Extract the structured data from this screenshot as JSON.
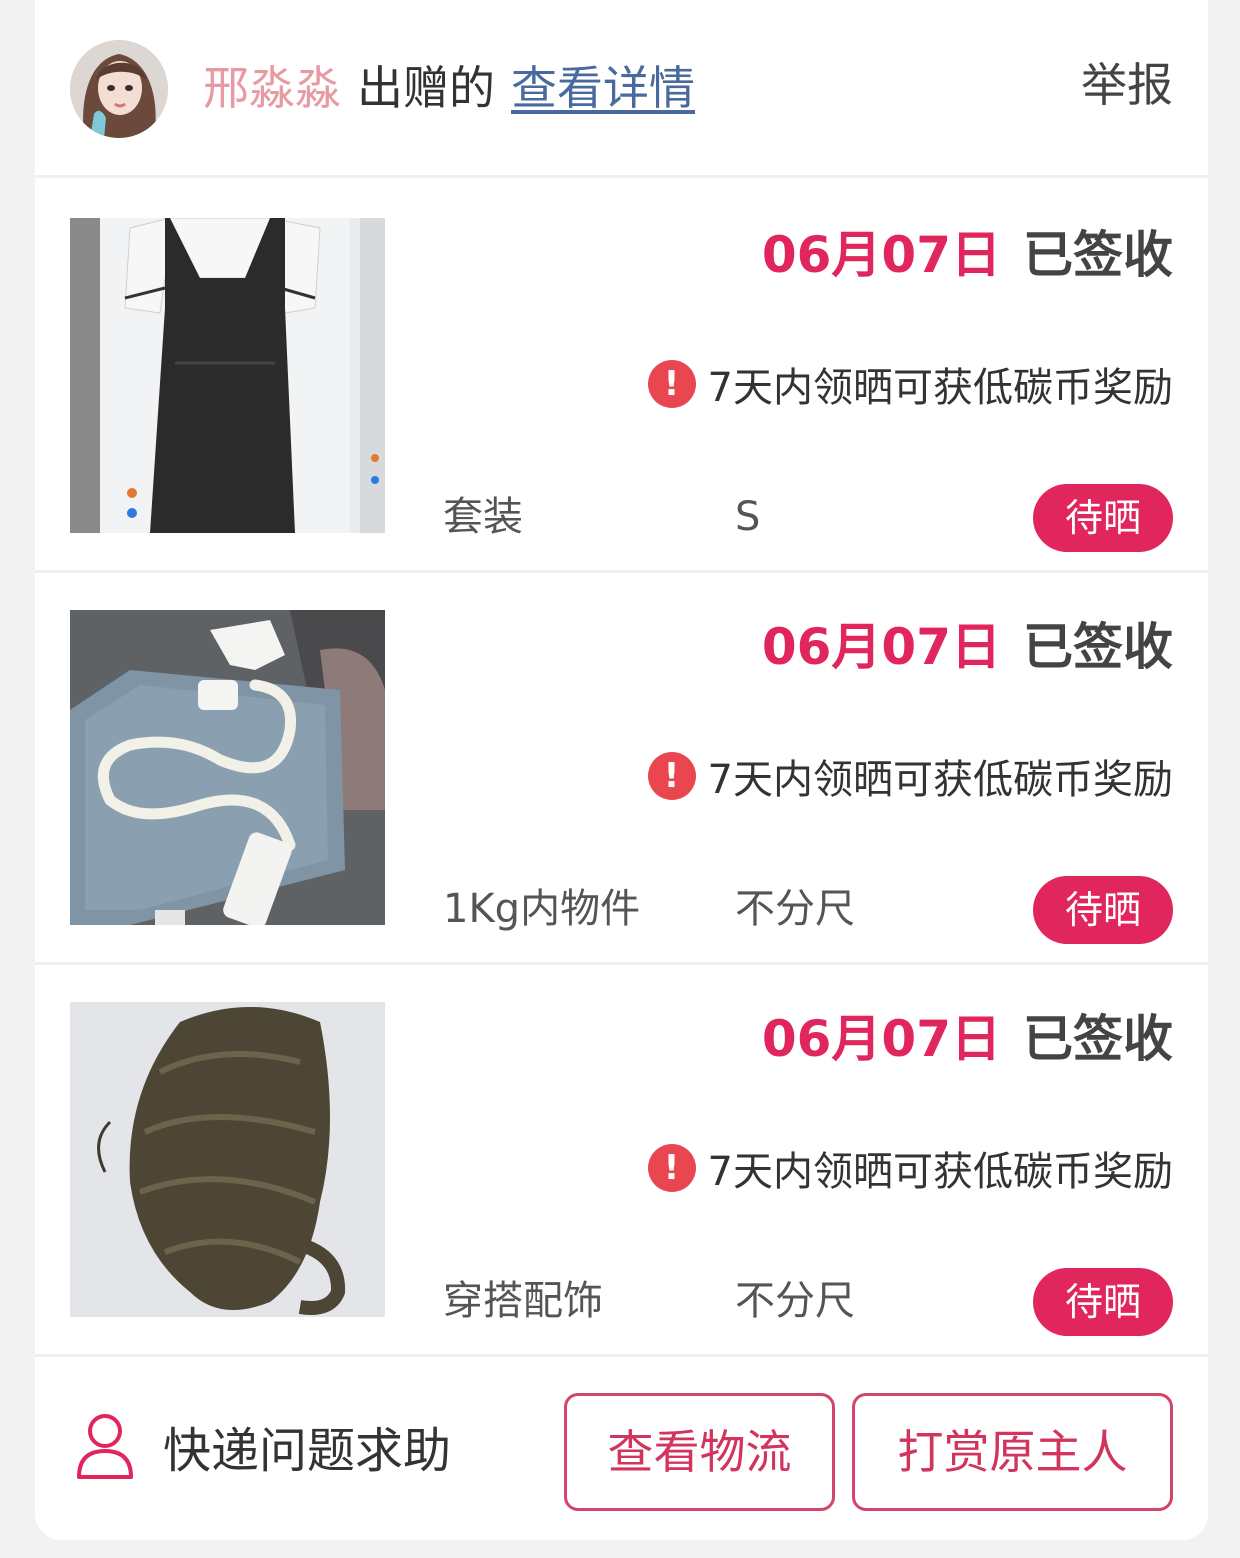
{
  "header": {
    "giver_name": "邢淼淼",
    "gave_label": "出赠的",
    "detail_link": "查看详情",
    "report_link": "举报"
  },
  "items": [
    {
      "date": "06月07日",
      "status": "已签收",
      "notice": "7天内领晒可获低碳币奖励",
      "category": "套装",
      "size": "S",
      "action": "待晒",
      "thumbnail": "black-sleeveless-jumpsuit-photo"
    },
    {
      "date": "06月07日",
      "status": "已签收",
      "notice": "7天内领晒可获低碳币奖励",
      "category": "1Kg内物件",
      "size": "不分尺",
      "action": "待晒",
      "thumbnail": "white-flexible-phone-holder-photo"
    },
    {
      "date": "06月07日",
      "status": "已签收",
      "notice": "7天内领晒可获低碳币奖励",
      "category": "穿搭配饰",
      "size": "不分尺",
      "action": "待晒",
      "thumbnail": "brown-curly-wig-photo"
    }
  ],
  "footer": {
    "help_label": "快递问题求助",
    "logistics_button": "查看物流",
    "reward_button": "打赏原主人"
  },
  "colors": {
    "accent": "#e0265c",
    "giver_name": "#e89aa3",
    "link": "#4a6a9e",
    "warning": "#e9464f"
  }
}
